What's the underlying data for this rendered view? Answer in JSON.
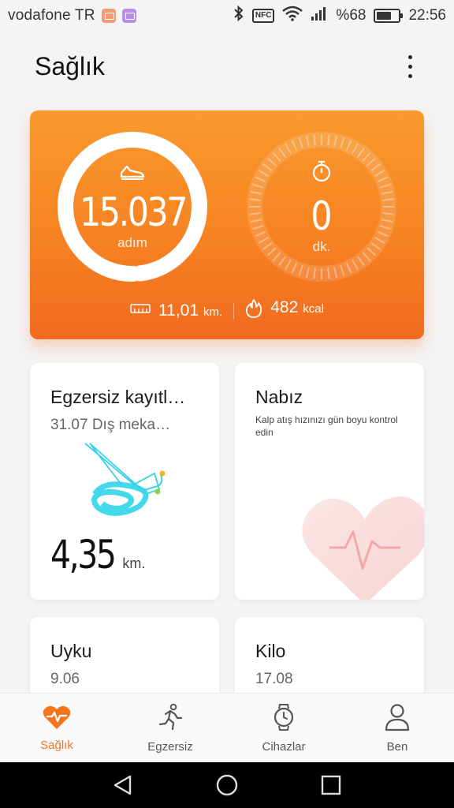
{
  "status_bar": {
    "carrier": "vodafone TR",
    "nfc": "NFC",
    "battery": "%68",
    "battery_level": 0.68,
    "time": "22:56"
  },
  "header": {
    "title": "Sağlık"
  },
  "activity": {
    "steps_value": "15.037",
    "steps_unit": "adım",
    "steps_goal_progress": 0.98,
    "time_value": "0",
    "time_unit": "dk.",
    "distance_value": "11,01",
    "distance_unit": "km.",
    "calories_value": "482",
    "calories_unit": "kcal",
    "accent_color": "#f68322"
  },
  "tiles": {
    "exercise": {
      "title": "Egzersiz kayıtl…",
      "subtitle": "31.07 Dış meka…",
      "value": "4,35",
      "unit": "km."
    },
    "heart_rate": {
      "title": "Nabız",
      "description": "Kalp atış hızınızı gün boyu kontrol edin"
    },
    "sleep": {
      "title": "Uyku",
      "subtitle": "9.06"
    },
    "weight": {
      "title": "Kilo",
      "subtitle": "17.08"
    }
  },
  "bottom_nav": {
    "items": [
      {
        "label": "Sağlık",
        "icon": "heart-pulse-icon",
        "active": true
      },
      {
        "label": "Egzersiz",
        "icon": "running-icon",
        "active": false
      },
      {
        "label": "Cihazlar",
        "icon": "watch-icon",
        "active": false
      },
      {
        "label": "Ben",
        "icon": "person-icon",
        "active": false
      }
    ],
    "active_color": "#f5751f"
  },
  "system_nav": {
    "buttons": [
      "back",
      "home",
      "recents"
    ]
  }
}
